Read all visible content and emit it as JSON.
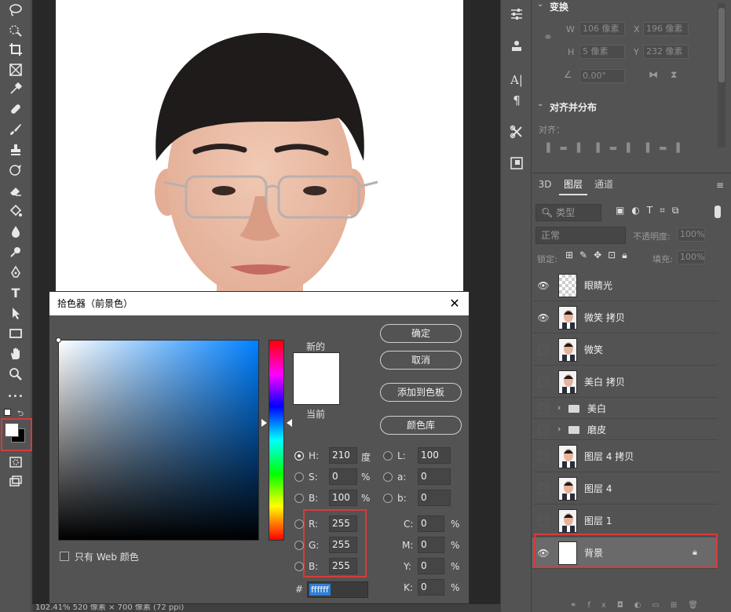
{
  "toolbar": {
    "tools": [
      "lasso-tool",
      "quick-select-tool",
      "crop-tool",
      "frame-tool",
      "eyedropper-tool",
      "healing-brush-tool",
      "brush-tool",
      "clone-stamp-tool",
      "history-brush-tool",
      "eraser-tool",
      "paint-bucket-tool",
      "blur-tool",
      "dodge-tool",
      "pen-tool",
      "type-tool",
      "path-select-tool",
      "rectangle-tool",
      "hand-tool",
      "zoom-tool",
      "more-tools"
    ],
    "type_glyph": "T",
    "more_glyph": "•••"
  },
  "status": {
    "text": "102.41%    520 像素 × 700 像素 (72 ppi)"
  },
  "color_picker": {
    "title": "拾色器（前景色）",
    "close": "✕",
    "new_label": "新的",
    "current_label": "当前",
    "buttons": {
      "ok": "确定",
      "cancel": "取消",
      "add_swatch": "添加到色板",
      "color_library": "颜色库"
    },
    "web_only_label": "只有 Web 颜色",
    "hsb": {
      "h_label": "H:",
      "h": "210",
      "h_unit": "度",
      "s_label": "S:",
      "s": "0",
      "s_unit": "%",
      "b_label": "B:",
      "b": "100",
      "b_unit": "%"
    },
    "rgb": {
      "r_label": "R:",
      "r": "255",
      "g_label": "G:",
      "g": "255",
      "b_label": "B:",
      "b": "255"
    },
    "lab": {
      "l_label": "L:",
      "l": "100",
      "a_label": "a:",
      "a": "0",
      "b_label": "b:",
      "b": "0"
    },
    "cmyk": {
      "c_label": "C:",
      "c": "0",
      "m_label": "M:",
      "m": "0",
      "y_label": "Y:",
      "y": "0",
      "k_label": "K:",
      "k": "0",
      "unit": "%"
    },
    "hex_label": "#",
    "hex": "ffffff"
  },
  "properties": {
    "transform_title": "变换",
    "w_label": "W",
    "w_value": "106 像素",
    "x_label": "X",
    "x_value": "196 像素",
    "h_label": "H",
    "h_value": "5 像素",
    "y_label": "Y",
    "y_value": "232 像素",
    "angle_value": "0.00°",
    "align_title": "对齐并分布",
    "align_label": "对齐："
  },
  "layers": {
    "tabs": [
      "3D",
      "图层",
      "通道"
    ],
    "active_tab": "图层",
    "filter_placeholder": "类型",
    "blend_mode": "正常",
    "opacity_label": "不透明度:",
    "opacity_value": "100%",
    "lock_label": "锁定:",
    "fill_label": "填充:",
    "fill_value": "100%",
    "items": [
      {
        "name": "眼睛光",
        "visible": true,
        "thumb": "transparent"
      },
      {
        "name": "微笑 拷贝",
        "visible": true,
        "thumb": "photo"
      },
      {
        "name": "微笑",
        "visible": false,
        "thumb": "photo"
      },
      {
        "name": "美白 拷贝",
        "visible": false,
        "thumb": "photo"
      },
      {
        "name": "美白",
        "visible": false,
        "thumb": "group"
      },
      {
        "name": "磨皮",
        "visible": false,
        "thumb": "group"
      },
      {
        "name": "图层 4 拷贝",
        "visible": false,
        "thumb": "photo"
      },
      {
        "name": "图层 4",
        "visible": false,
        "thumb": "photo"
      },
      {
        "name": "图层 1",
        "visible": false,
        "thumb": "photo"
      },
      {
        "name": "背景",
        "visible": true,
        "thumb": "white",
        "locked": true
      }
    ]
  },
  "colors": {
    "highlight": "#d83a3a",
    "foreground": "#ffffff",
    "background": "#000000"
  }
}
